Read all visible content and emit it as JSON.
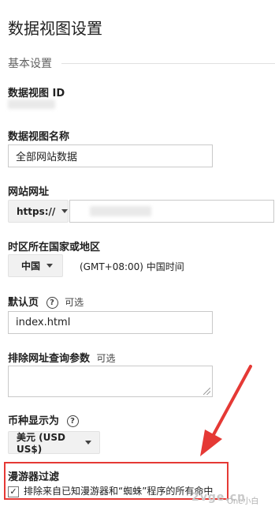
{
  "page": {
    "title": "数据视图设置"
  },
  "basic": {
    "section_title": "基本设置"
  },
  "view_id": {
    "label": "数据视图 ID"
  },
  "view_name": {
    "label": "数据视图名称",
    "value": "全部网站数据"
  },
  "website_url": {
    "label": "网站网址",
    "protocol": "https://"
  },
  "timezone": {
    "label": "时区所在国家或地区",
    "country": "中国",
    "zone": "(GMT+08:00) 中国时间"
  },
  "default_page": {
    "label": "默认页",
    "help": "?",
    "optional": "可选",
    "value": "index.html"
  },
  "exclude_params": {
    "label": "排除网址查询参数",
    "optional": "可选"
  },
  "currency": {
    "label": "币种显示为",
    "help": "?",
    "value": "美元 (USD US$)"
  },
  "bot_filtering": {
    "label": "漫游器过滤",
    "checkbox_label": "排除来自已知漫游器和“蜘蛛”程序的所有命中",
    "checked": "✓"
  },
  "watermark": {
    "text": "2vge.cn",
    "sub": "One小白"
  },
  "colors": {
    "highlight": "#e53935"
  }
}
